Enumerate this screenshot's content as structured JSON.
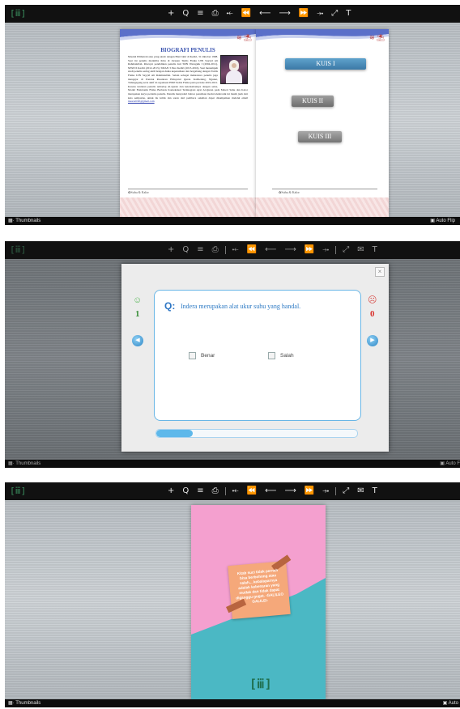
{
  "logo_glyph": "[ⅲ]",
  "toolbar1": [
    "+",
    "Q",
    "≡",
    "⎙",
    "⤝",
    "⏪",
    "⟵",
    "⟶",
    "⏩",
    "⤞",
    "⤢",
    "T"
  ],
  "toolbar2": [
    "+",
    "Q",
    "≡",
    "⎙",
    "⤝",
    "⏪",
    "⟵",
    "⟶",
    "⏩",
    "⤞",
    "⤢",
    "✉",
    "T"
  ],
  "bottom": {
    "thumbnails": "Thumbnails",
    "autoflip": "Auto Flip",
    "autoflip_short": "Auto F",
    "autoflip_tiny": "Auto"
  },
  "book": {
    "deco": "≋ ⛱",
    "bio_title": "BIOGRAFI PENULIS",
    "bio_text": "Masrial Pilihatrah atau yang akrab dengan Bisri lahir di Kediri, 31 Oktober 1998. Saat ini penulis menimba ilmu di Jurusan Tadris Fisika UIN Sayyid Ali Rahmatullah. Riwayat pendidikan penulis dari SDN Waruguik I (2004-2011), MTsN 6 Kediri (2012-2013), SMAN 3 Pare Kediri (2013-2016). Saat menempuh studi penulis sering aktif dengan dunia kepenulisan dan bergabung dengan Tadris Fisika UIN Sayyid Ali Rahmatullah. Selain sebagai mahasiswa penulis juga mengajar di Pondok Pesantren Hidayatul Quran Kalibening, Ngunut, Tulungagung serta aktif di organisasi HMJ Tadris Fisika pada periode 2019-2021. Karena tuntutan penulis terhadap Al-Quran dan keterkaitannya dengan sains, Modul Elektronik Fisika Berbasis Kontekstual Terintegrasi Ayat Al-Quran pada Materi Suhu dan Kalor merupakan karya pertama penulis. Penulis menyadari bahwa penulisan modul elektronik ini masih jauh dari kata sempurna, untuk itu kritik dan saran dari pembaca sekalian dapat disampaikan melalui email",
    "email": "masrial190@gmail.com",
    "footer": "✿Suhu & Kalor",
    "kuis": [
      "KUIS I",
      "KUIS II",
      "KUIS III"
    ]
  },
  "quiz": {
    "close": "×",
    "correct_icon": "☺",
    "wrong_icon": "☹",
    "correct_count": "1",
    "wrong_count": "0",
    "q_label": "Q:",
    "question": "Indera merupakan alat ukur suhu yang handal.",
    "options": [
      "Benar",
      "Salah"
    ],
    "prev": "◀",
    "next": "▶",
    "progress": 0.18
  },
  "cover": {
    "quote": "Kitab suci tidak pernah bisa berbohong atau salah... kebalaparnya adalah kebenaran yang mutlak dan tidak dapat diganggu gugat. -GALILEO GALILEI-",
    "logo": "[ⅲ]"
  },
  "colors": {
    "pink": "#f4a0cf",
    "teal": "#4bb8c4",
    "note": "#f5a87a",
    "accent": "#2e87c6"
  }
}
